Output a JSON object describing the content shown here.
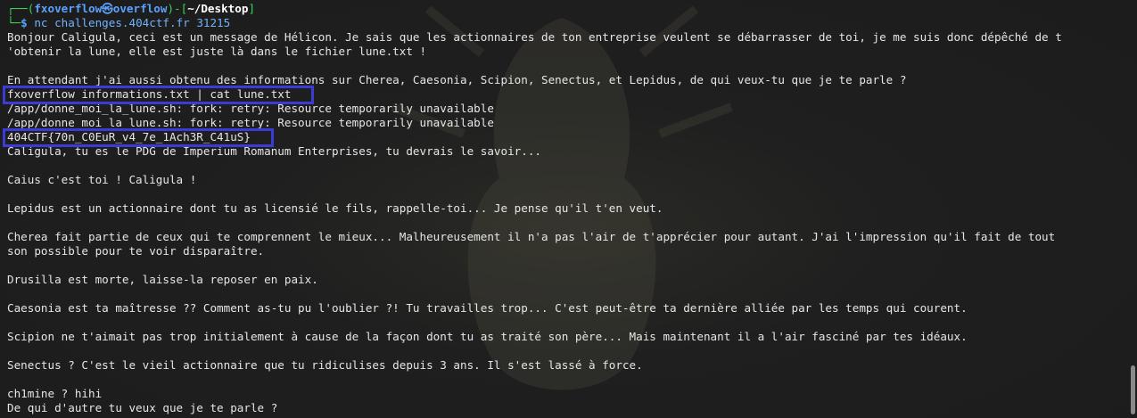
{
  "prompt": {
    "corner_top": "┌──(",
    "user": "fxoverflow",
    "at_symbol": "㉿",
    "host": "overflow",
    "sep": ")-[",
    "path": "~/Desktop",
    "end": "]",
    "corner_bottom": "└─",
    "dollar": "$ ",
    "command": "nc challenges.404ctf.fr 31215"
  },
  "lines": [
    "Bonjour Caligula, ceci est un message de Hélicon. Je sais que les actionnaires de ton entreprise veulent se débarrasser de toi, je me suis donc dépêché de t",
    "'obtenir la lune, elle est juste là dans le fichier lune.txt !",
    "",
    "En attendant j'ai aussi obtenu des informations sur Cherea, Caesonia, Scipion, Senectus, et Lepidus, de qui veux-tu que je te parle ?",
    "fxoverflow informations.txt | cat lune.txt",
    "/app/donne_moi_la_lune.sh: fork: retry: Resource temporarily unavailable",
    "/app/donne_moi_la_lune.sh: fork: retry: Resource temporarily unavailable",
    "404CTF{70n_C0EuR_v4_7e_1Ach3R_C41uS}",
    "Caligula, tu es le PDG de Imperium Romanum Enterprises, tu devrais le savoir...",
    "",
    "Caius c'est toi ! Caligula !",
    "",
    "Lepidus est un actionnaire dont tu as licensié le fils, rappelle-toi... Je pense qu'il t'en veut.",
    "",
    "Cherea fait partie de ceux qui te comprennent le mieux... Malheureusement il n'a pas l'air de t'apprécier pour autant. J'ai l'impression qu'il fait de tout",
    "son possible pour te voir disparaître.",
    "",
    "Drusilla est morte, laisse-la reposer en paix.",
    "",
    "Caesonia est ta maîtresse ?? Comment as-tu pu l'oublier ?! Tu travailles trop... C'est peut-être ta dernière alliée par les temps qui courent.",
    "",
    "Scipion ne t'aimait pas trop initialement à cause de la façon dont tu as traité son père... Mais maintenant il a l'air fasciné par tes idéaux.",
    "",
    "Senectus ? C'est le vieil actionnaire que tu ridiculises depuis 3 ans. Il s'est lassé à force.",
    "",
    "ch1mine ? hihi",
    "De qui d'autre tu veux que je te parle ?"
  ],
  "colors": {
    "background": "#1e1e1e",
    "text": "#e6e6e6",
    "prompt_green": "#39d353",
    "prompt_blue": "#5aa2ff",
    "highlight_box": "#3b3bd6"
  }
}
